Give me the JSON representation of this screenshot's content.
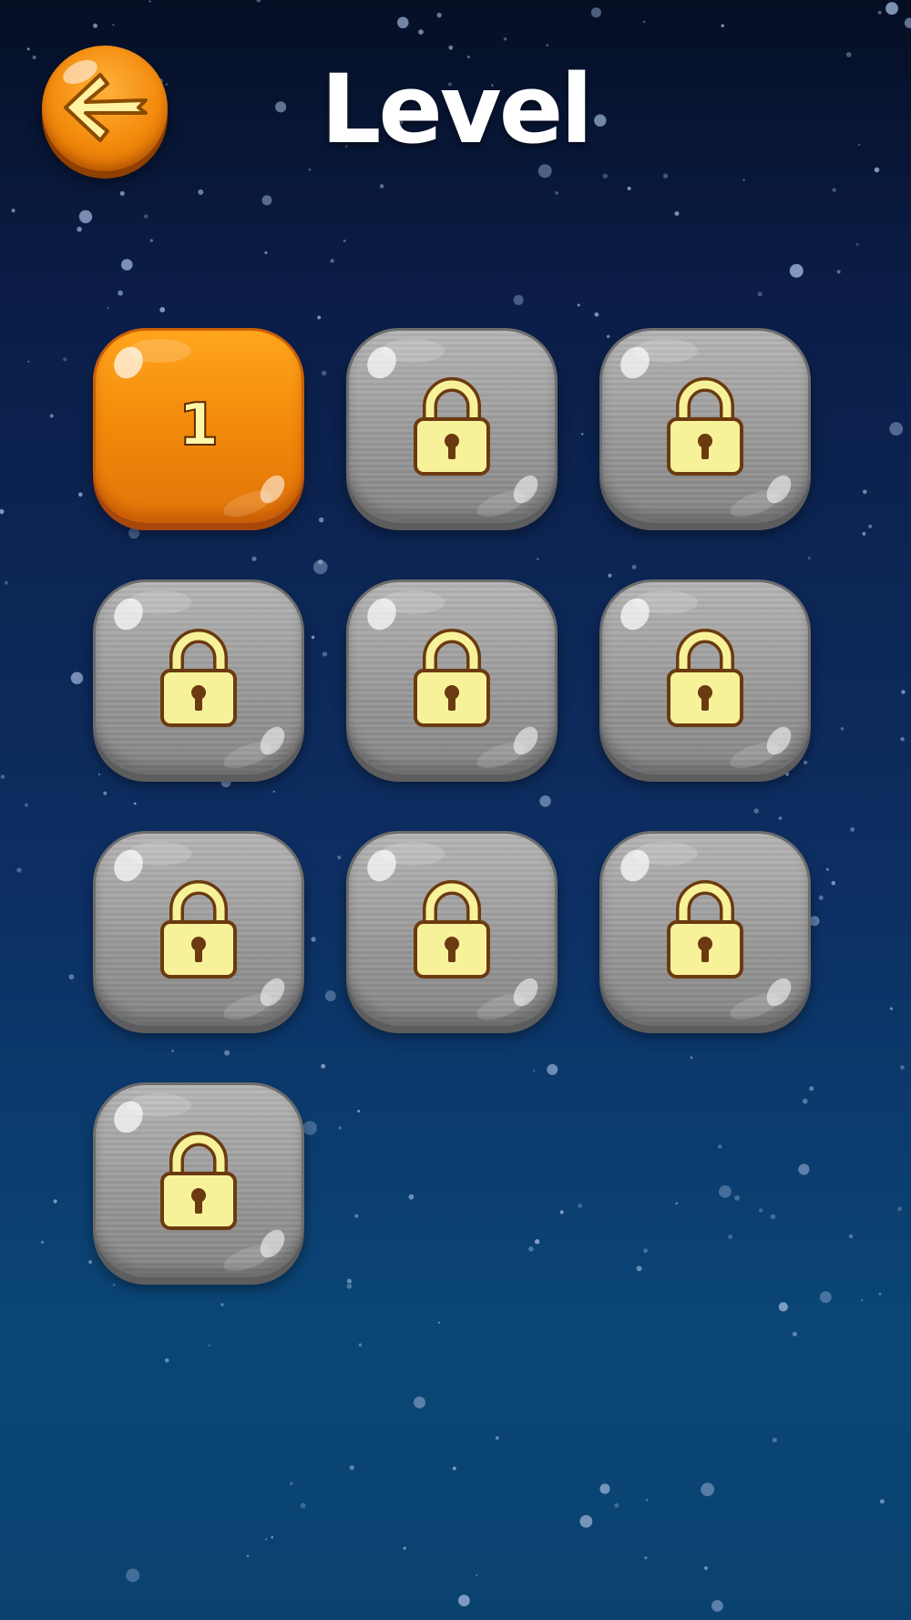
{
  "header": {
    "title": "Level",
    "back_icon": "back-arrow-icon"
  },
  "colors": {
    "unlocked_tile": "#f28a0b",
    "locked_tile": "#9c9c9c",
    "lock_fill": "#f7f29a",
    "lock_outline": "#6b3a10",
    "title_text": "#ffffff"
  },
  "levels": [
    {
      "label": "1",
      "locked": false
    },
    {
      "label": "",
      "locked": true,
      "icon": "lock-icon"
    },
    {
      "label": "",
      "locked": true,
      "icon": "lock-icon"
    },
    {
      "label": "",
      "locked": true,
      "icon": "lock-icon"
    },
    {
      "label": "",
      "locked": true,
      "icon": "lock-icon"
    },
    {
      "label": "",
      "locked": true,
      "icon": "lock-icon"
    },
    {
      "label": "",
      "locked": true,
      "icon": "lock-icon"
    },
    {
      "label": "",
      "locked": true,
      "icon": "lock-icon"
    },
    {
      "label": "",
      "locked": true,
      "icon": "lock-icon"
    },
    {
      "label": "",
      "locked": true,
      "icon": "lock-icon"
    }
  ]
}
